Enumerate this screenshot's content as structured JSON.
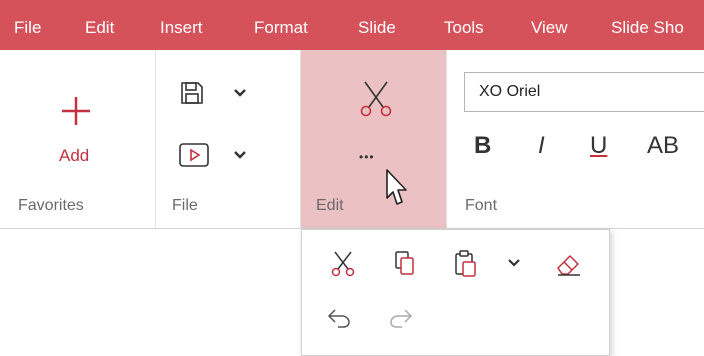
{
  "menubar": {
    "items": [
      "File",
      "Edit",
      "Insert",
      "Format",
      "Slide",
      "Tools",
      "View",
      "Slide Sho"
    ]
  },
  "colors": {
    "accent": "#d6525b",
    "icon_red": "#c4303e",
    "edit_group_highlight": "#ecc1c4"
  },
  "favorites": {
    "add_label": "Add",
    "group_label": "Favorites"
  },
  "file_group": {
    "label": "File"
  },
  "edit_group": {
    "label": "Edit",
    "more_label": "•••"
  },
  "font_group": {
    "label": "Font",
    "font_name": "XO Oriel",
    "bold_label": "B",
    "italic_label": "I",
    "underline_label": "U",
    "strike_label": "AB"
  },
  "icons": {
    "add": "plus-icon",
    "save": "save-icon",
    "slideshow": "play-icon",
    "cut": "scissors-icon",
    "copy": "copy-icon",
    "paste": "paste-icon",
    "eraser": "eraser-icon",
    "undo": "undo-icon",
    "redo": "redo-icon",
    "dropdown": "chevron-down-icon",
    "cursor": "mouse-cursor-icon"
  }
}
